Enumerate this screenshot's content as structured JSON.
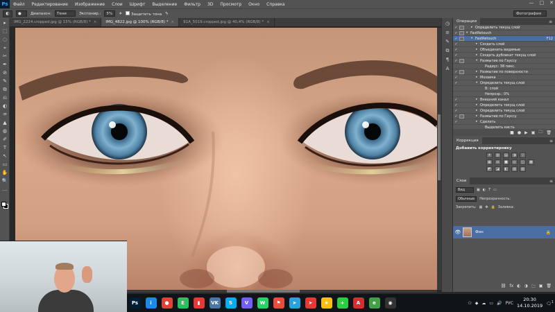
{
  "app": {
    "logo": "Ps",
    "window_controls": [
      "—",
      "□",
      "✕"
    ]
  },
  "menu": [
    "Файл",
    "Редактирование",
    "Изображение",
    "Слои",
    "Шрифт",
    "Выделение",
    "Фильтр",
    "3D",
    "Просмотр",
    "Окно",
    "Справка"
  ],
  "options": {
    "range_label": "Диапазон:",
    "range_value": "Тени",
    "exposure_label": "Экспонир.:",
    "exposure_value": "5%",
    "protect_label": "Защитить тона",
    "workspace": "Фотография"
  },
  "doc_tabs": [
    {
      "label": "IMG_2224.cropped.jpg @ 15% (RGB/8) *",
      "active": false
    },
    {
      "label": "IMG_4822.jpg @ 100% (RGB/8) *",
      "active": true
    },
    {
      "label": "91A_5019.cropped.jpg @ 40,4% (RGB/8) *",
      "active": false
    }
  ],
  "tools": [
    "▸",
    "⬚",
    "◌",
    "⌖",
    "✂",
    "✒",
    "⊘",
    "✎",
    "⧉",
    "⎌",
    "◐",
    "♒",
    "▲",
    "◍",
    "✐",
    "T",
    "↖",
    "▭",
    "✋",
    "🔍",
    "…"
  ],
  "actions_panel": {
    "tab": "Операции",
    "rows": [
      {
        "check": "✓",
        "dialog": true,
        "arrow": "▸",
        "indent": 1,
        "text": "Определить текущ слой",
        "selected": false
      },
      {
        "check": "✓",
        "dialog": true,
        "arrow": "▾",
        "indent": 0,
        "text": "FastRetouch",
        "selected": false
      },
      {
        "check": "✓",
        "dialog": true,
        "arrow": "▾",
        "indent": 1,
        "text": "FastRetouch",
        "selected": true,
        "shortcut": "F12"
      },
      {
        "check": "✓",
        "dialog": false,
        "arrow": "▸",
        "indent": 2,
        "text": "Создать слой",
        "selected": false
      },
      {
        "check": "✓",
        "dialog": false,
        "arrow": "▸",
        "indent": 2,
        "text": "Объединить видимые",
        "selected": false
      },
      {
        "check": "✓",
        "dialog": false,
        "arrow": "▸",
        "indent": 2,
        "text": "Создать дубликат текущ слой",
        "selected": false
      },
      {
        "check": "✓",
        "dialog": true,
        "arrow": "▾",
        "indent": 2,
        "text": "Размытие по Гауссу",
        "selected": false
      },
      {
        "check": "",
        "dialog": false,
        "arrow": "",
        "indent": 3,
        "text": "Радиус: 38 пикс.",
        "selected": false
      },
      {
        "check": "✓",
        "dialog": true,
        "arrow": "▸",
        "indent": 2,
        "text": "Размытие по поверхности",
        "selected": false
      },
      {
        "check": "✓",
        "dialog": false,
        "arrow": "▸",
        "indent": 2,
        "text": "Мозаика",
        "selected": false
      },
      {
        "check": "✓",
        "dialog": false,
        "arrow": "▾",
        "indent": 2,
        "text": "Определить текущ слой",
        "selected": false
      },
      {
        "check": "",
        "dialog": false,
        "arrow": "",
        "indent": 3,
        "text": "В: слой",
        "selected": false
      },
      {
        "check": "",
        "dialog": false,
        "arrow": "",
        "indent": 3,
        "text": "Непрозр.: 0%",
        "selected": false
      },
      {
        "check": "✓",
        "dialog": false,
        "arrow": "▸",
        "indent": 2,
        "text": "Внешний канал",
        "selected": false
      },
      {
        "check": "✓",
        "dialog": false,
        "arrow": "▸",
        "indent": 2,
        "text": "Определить текущ слой",
        "selected": false
      },
      {
        "check": "✓",
        "dialog": false,
        "arrow": "▸",
        "indent": 2,
        "text": "Определить текущ слой",
        "selected": false
      },
      {
        "check": "✓",
        "dialog": true,
        "arrow": "▸",
        "indent": 2,
        "text": "Размытие по Гауссу",
        "selected": false
      },
      {
        "check": "✓",
        "dialog": false,
        "arrow": "▸",
        "indent": 2,
        "text": "Сделать",
        "selected": false
      },
      {
        "check": "",
        "dialog": false,
        "arrow": "",
        "indent": 3,
        "text": "Выделить кисть",
        "selected": false
      }
    ],
    "bottom_icons": [
      "■",
      "●",
      "▶",
      "▣",
      "🗀",
      "🗑"
    ]
  },
  "adjustments_panel": {
    "tab": "Коррекция",
    "title": "Добавить корректировку",
    "row1": [
      "☀",
      "▥",
      "▤",
      "◑",
      "▽"
    ],
    "row2": [
      "▦",
      "⚖",
      "■",
      "◎",
      "◫",
      "▩"
    ],
    "row3": [
      "◩",
      "◪",
      "◧",
      "▨",
      "▧"
    ]
  },
  "layers_panel": {
    "tab": "Слои",
    "kind_label": "Вид",
    "blend_mode": "Обычные",
    "opacity_label": "Непрозрачность:",
    "lock_label": "Закрепить:",
    "fill_label": "Заливка:",
    "layer": {
      "name": "Фон",
      "visible_icon": "👁",
      "lock_icon": "🔒"
    },
    "bottom_icons": [
      "⛓",
      "fx",
      "◐",
      "◑",
      "🗀",
      "▣",
      "🗑"
    ]
  },
  "taskbar": {
    "apps": [
      {
        "name": "photoshop-icon",
        "glyph": "Ps",
        "color": "#001e36"
      },
      {
        "name": "info-icon",
        "glyph": "i",
        "color": "#1e88e5"
      },
      {
        "name": "chrome-icon",
        "glyph": "●",
        "color": "#db4437"
      },
      {
        "name": "evernote-icon",
        "glyph": "E",
        "color": "#2dbe60"
      },
      {
        "name": "bookmark-icon",
        "glyph": "▮",
        "color": "#e53935"
      },
      {
        "name": "vk-icon",
        "glyph": "VK",
        "color": "#4a76a8"
      },
      {
        "name": "skype-icon",
        "glyph": "S",
        "color": "#00aff0"
      },
      {
        "name": "viber-icon",
        "glyph": "V",
        "color": "#7360f2"
      },
      {
        "name": "whatsapp-icon",
        "glyph": "W",
        "color": "#25d366"
      },
      {
        "name": "flag-icon",
        "glyph": "⚑",
        "color": "#e74c3c"
      },
      {
        "name": "telegram-icon",
        "glyph": "➤",
        "color": "#2aa1da"
      },
      {
        "name": "telegram-red-icon",
        "glyph": "➤",
        "color": "#e53935"
      },
      {
        "name": "star-icon",
        "glyph": "★",
        "color": "#f9c00c"
      },
      {
        "name": "plus-icon",
        "glyph": "+",
        "color": "#2ecc40"
      },
      {
        "name": "acrobat-icon",
        "glyph": "A",
        "color": "#d32f2f"
      },
      {
        "name": "green-app-icon",
        "glyph": "e",
        "color": "#43a047"
      },
      {
        "name": "obs-icon",
        "glyph": "◉",
        "color": "#333333"
      }
    ],
    "tray": {
      "lang": "РУС",
      "time": "20:30",
      "date": "14.10.2019",
      "notifications": "1"
    }
  }
}
